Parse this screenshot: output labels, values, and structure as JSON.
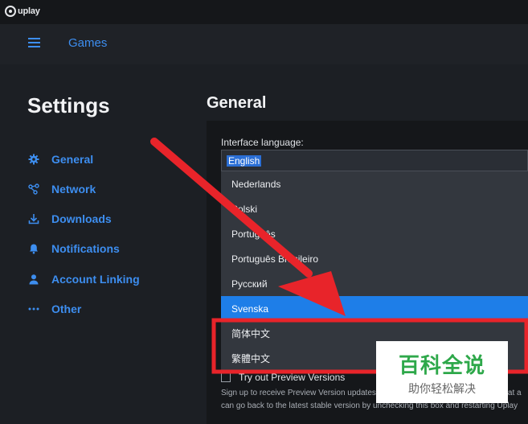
{
  "app": {
    "logo_text": "uplay"
  },
  "topnav": {
    "games_label": "Games"
  },
  "sidebar": {
    "title": "Settings",
    "items": [
      {
        "label": "General",
        "icon": "gear-icon"
      },
      {
        "label": "Network",
        "icon": "network-icon"
      },
      {
        "label": "Downloads",
        "icon": "download-icon"
      },
      {
        "label": "Notifications",
        "icon": "bell-icon"
      },
      {
        "label": "Account Linking",
        "icon": "user-icon"
      },
      {
        "label": "Other",
        "icon": "more-icon"
      }
    ]
  },
  "main": {
    "title": "General",
    "interface_language_label": "Interface language:",
    "selected_language": "English",
    "language_options": [
      {
        "label": "Nederlands",
        "selected": false
      },
      {
        "label": "Polski",
        "selected": false
      },
      {
        "label": "Português",
        "selected": false
      },
      {
        "label": "Português Brasileiro",
        "selected": false
      },
      {
        "label": "Русский",
        "selected": false
      },
      {
        "label": "Svenska",
        "selected": true
      },
      {
        "label": "简体中文",
        "selected": false
      },
      {
        "label": "繁體中文",
        "selected": false
      }
    ],
    "preview_label": "Try out Preview Versions",
    "preview_desc_line1": "Sign up to receive Preview Version updates. You can opt out at any time. Note that a",
    "preview_desc_line2": "can go back to the latest stable version by unchecking this box and restarting Uplay"
  },
  "watermark": {
    "title": "百科全说",
    "subtitle": "助你轻松解决"
  },
  "colors": {
    "accent": "#3d8ef0",
    "selected": "#1e7ee8",
    "annotation_red": "#e8242a",
    "watermark_green": "#2ea84a"
  }
}
